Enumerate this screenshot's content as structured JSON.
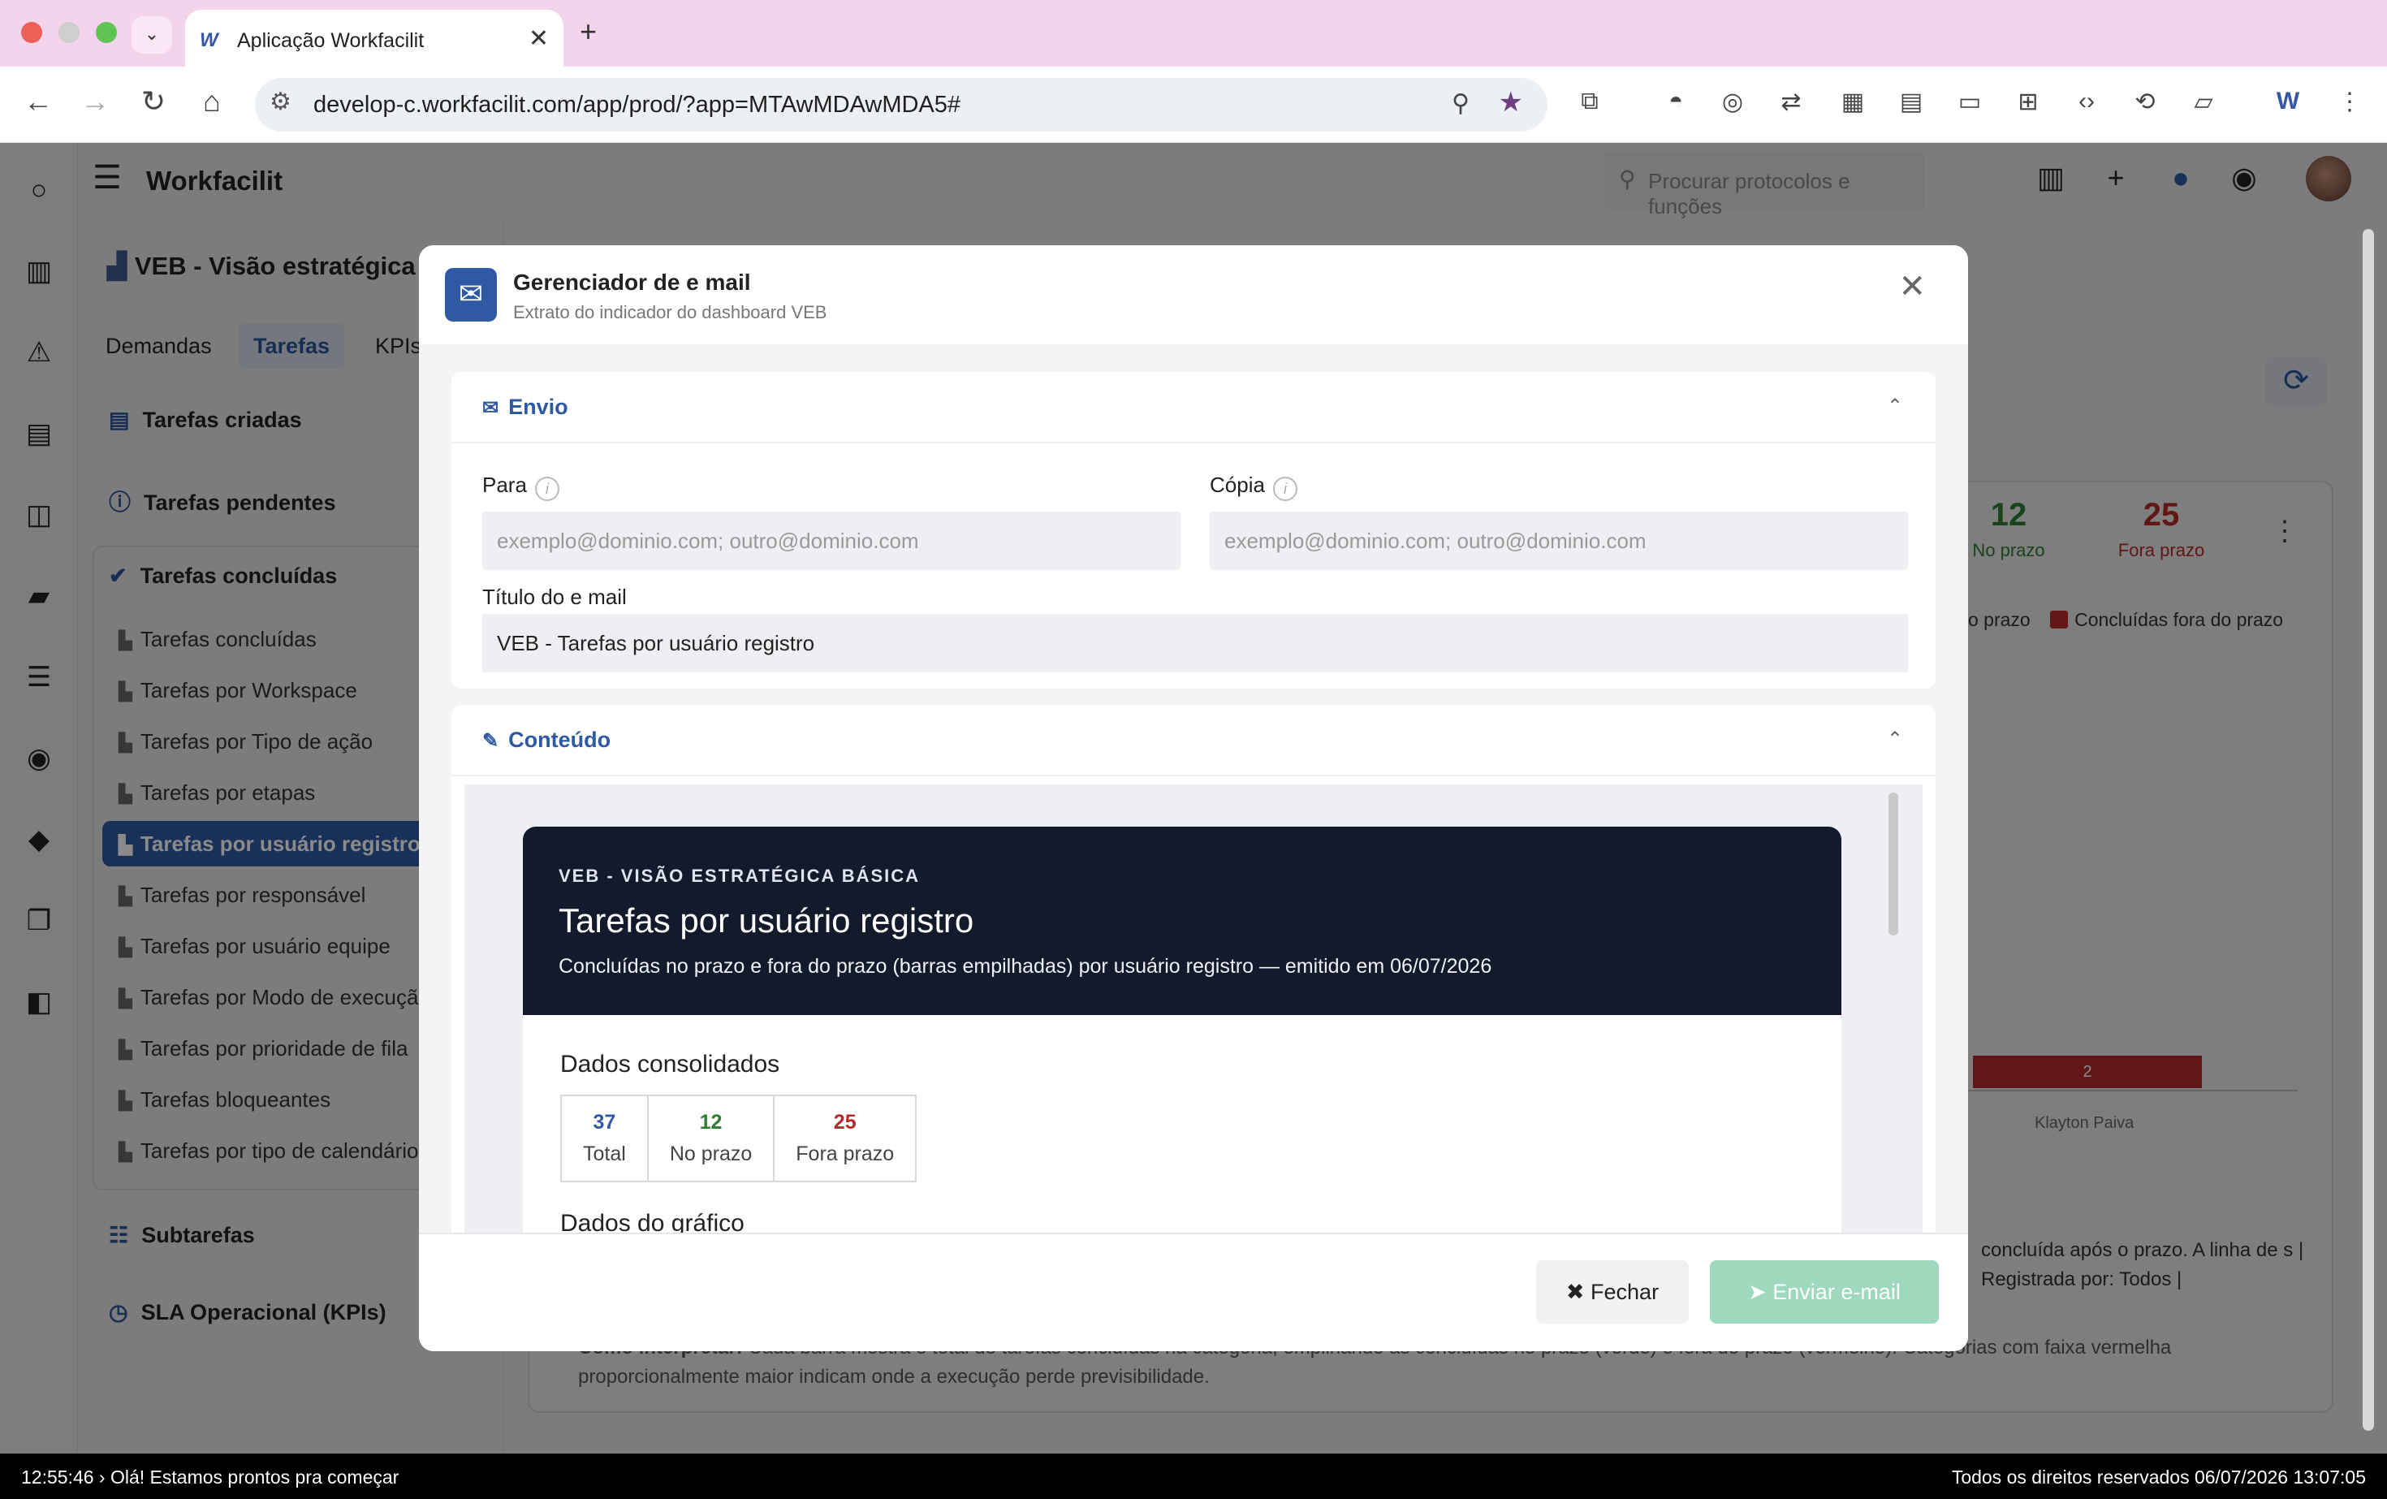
{
  "browser": {
    "tab_title": "Aplicação Workfacilit",
    "tab_favicon": "W",
    "url": "develop-c.workfacilit.com/app/prod/?app=MTAwMDAwMDA5#"
  },
  "app": {
    "name": "Workfacilit",
    "search_placeholder": "Procurar protocolos e funções"
  },
  "page": {
    "title": "VEB - Visão estratégica",
    "tabs": [
      "Demandas",
      "Tarefas",
      "KPIs"
    ],
    "active_tab": "Tarefas"
  },
  "sidebar": {
    "groups": [
      {
        "label": "Tarefas criadas"
      },
      {
        "label": "Tarefas pendentes"
      },
      {
        "label": "Tarefas concluídas"
      },
      {
        "label": "Subtarefas"
      },
      {
        "label": "SLA Operacional (KPIs)"
      }
    ],
    "items": [
      "Tarefas concluídas",
      "Tarefas por Workspace",
      "Tarefas por Tipo de ação",
      "Tarefas por etapas",
      "Tarefas por usuário registro",
      "Tarefas por responsável",
      "Tarefas por usuário equipe",
      "Tarefas por Modo de execução",
      "Tarefas por prioridade de fila",
      "Tarefas bloqueantes",
      "Tarefas por tipo de calendário"
    ],
    "active_item": "Tarefas por usuário registro"
  },
  "background": {
    "kpis": [
      {
        "value": "12",
        "label": "No prazo",
        "color": "#2e7d32"
      },
      {
        "value": "25",
        "label": "Fora prazo",
        "color": "#b52a2a"
      }
    ],
    "legend": [
      "o prazo",
      "Concluídas fora do prazo"
    ],
    "bar_value": "2",
    "bar_label": "Klayton Paiva",
    "text_right": "concluída após o prazo. A linha de s | Registrada por: Todos |",
    "text_bottom_lead": "Como interpretar:",
    "text_bottom": "Cada barra mostra o total de tarefas concluídas na categoria, empilhando as concluídas no prazo (verde) e fora do prazo (vermelho). Categorias com faixa vermelha proporcionalmente maior indicam onde a execução perde previsibilidade."
  },
  "modal": {
    "title": "Gerenciador de e mail",
    "subtitle": "Extrato do indicador do dashboard VEB",
    "envio": {
      "section_title": "Envio",
      "para_label": "Para",
      "para_placeholder": "exemplo@dominio.com; outro@dominio.com",
      "copia_label": "Cópia",
      "copia_placeholder": "exemplo@dominio.com; outro@dominio.com",
      "titulo_label": "Título do e mail",
      "titulo_value": "VEB - Tarefas por usuário registro"
    },
    "conteudo": {
      "section_title": "Conteúdo",
      "email_overline": "VEB - VISÃO ESTRATÉGICA BÁSICA",
      "email_title": "Tarefas por usuário registro",
      "email_subtitle": "Concluídas no prazo e fora do prazo (barras empilhadas) por usuário registro — emitido em 06/07/2026",
      "dados_title": "Dados consolidados",
      "stats": [
        {
          "value": "37",
          "label": "Total",
          "color": "#2f5aa3"
        },
        {
          "value": "12",
          "label": "No prazo",
          "color": "#2e7d32"
        },
        {
          "value": "25",
          "label": "Fora prazo",
          "color": "#b52a2a"
        }
      ],
      "grafico_title": "Dados do gráfico"
    },
    "buttons": {
      "close": "Fechar",
      "send": "Enviar e-mail"
    }
  },
  "statusbar": {
    "left": "12:55:46 › Olá! Estamos prontos pra começar",
    "right": "Todos os direitos reservados 06/07/2026 13:07:05"
  }
}
